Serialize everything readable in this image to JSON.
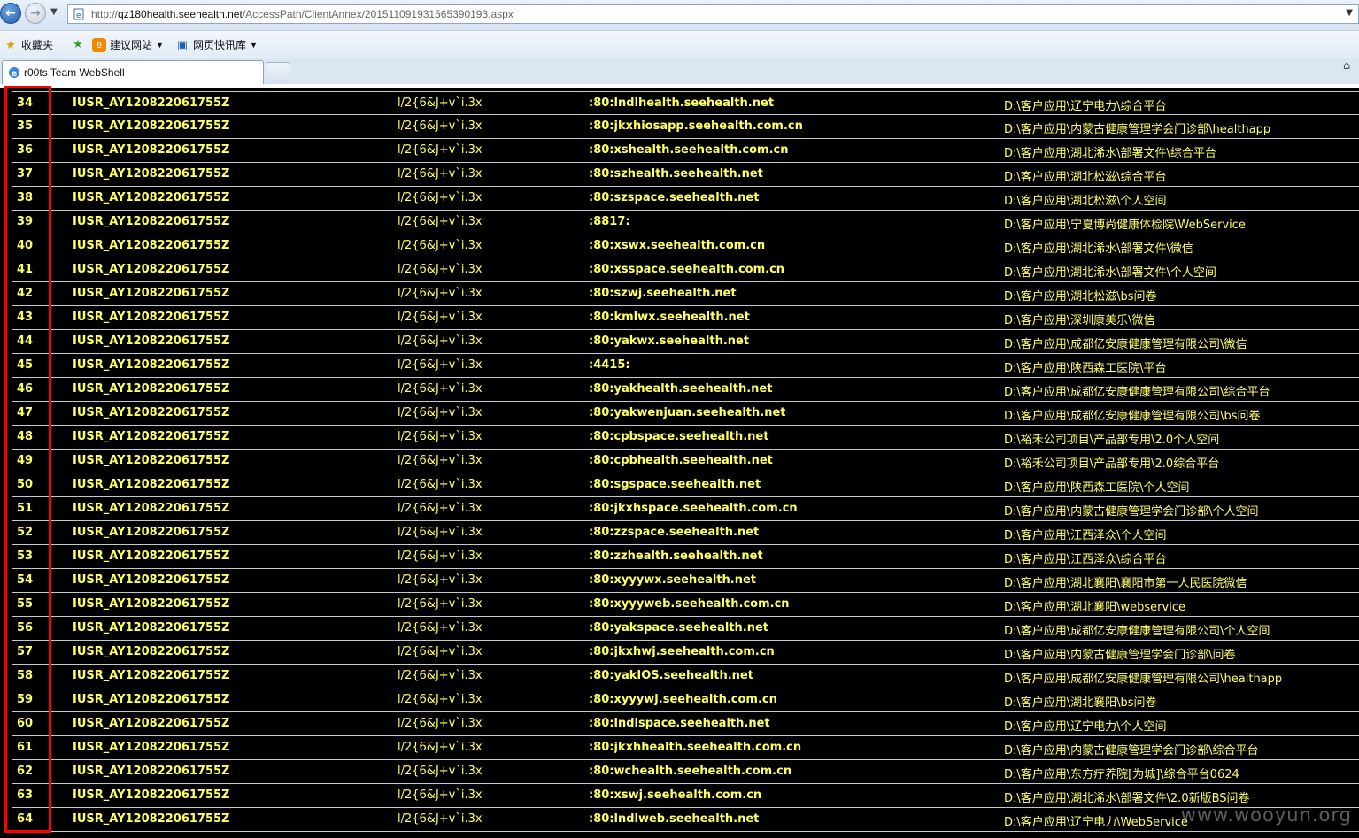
{
  "browser": {
    "url_prefix": "http://",
    "url_host": "qz180health.seehealth.net",
    "url_path": "/AccessPath/ClientAnnex/201511091931565390193.aspx",
    "favorites_label": "收藏夹",
    "fav_items": [
      "建议网站",
      "网页快讯库"
    ],
    "tab_title": "r00ts Team WebShell"
  },
  "table": {
    "user": "IUSR_AY120822061755Z",
    "password": "l/2{6&J+v`i.3x",
    "rows": [
      {
        "id": "34",
        "binding": ":80:lndlhealth.seehealth.net",
        "path": "D:\\客户应用\\辽宁电力\\综合平台"
      },
      {
        "id": "35",
        "binding": ":80:jkxhiosapp.seehealth.com.cn",
        "path": "D:\\客户应用\\内蒙古健康管理学会门诊部\\healthapp"
      },
      {
        "id": "36",
        "binding": ":80:xshealth.seehealth.com.cn",
        "path": "D:\\客户应用\\湖北浠水\\部署文件\\综合平台"
      },
      {
        "id": "37",
        "binding": ":80:szhealth.seehealth.net",
        "path": "D:\\客户应用\\湖北松滋\\综合平台"
      },
      {
        "id": "38",
        "binding": ":80:szspace.seehealth.net",
        "path": "D:\\客户应用\\湖北松滋\\个人空间"
      },
      {
        "id": "39",
        "binding": ":8817:",
        "path": "D:\\客户应用\\宁夏博尚健康体检院\\WebService"
      },
      {
        "id": "40",
        "binding": ":80:xswx.seehealth.com.cn",
        "path": "D:\\客户应用\\湖北浠水\\部署文件\\微信"
      },
      {
        "id": "41",
        "binding": ":80:xsspace.seehealth.com.cn",
        "path": "D:\\客户应用\\湖北浠水\\部署文件\\个人空间"
      },
      {
        "id": "42",
        "binding": ":80:szwj.seehealth.net",
        "path": "D:\\客户应用\\湖北松滋\\bs问卷"
      },
      {
        "id": "43",
        "binding": ":80:kmlwx.seehealth.net",
        "path": "D:\\客户应用\\深圳康美乐\\微信"
      },
      {
        "id": "44",
        "binding": ":80:yakwx.seehealth.net",
        "path": "D:\\客户应用\\成都亿安康健康管理有限公司\\微信"
      },
      {
        "id": "45",
        "binding": ":4415:",
        "path": "D:\\客户应用\\陕西森工医院\\平台"
      },
      {
        "id": "46",
        "binding": ":80:yakhealth.seehealth.net",
        "path": "D:\\客户应用\\成都亿安康健康管理有限公司\\综合平台"
      },
      {
        "id": "47",
        "binding": ":80:yakwenjuan.seehealth.net",
        "path": "D:\\客户应用\\成都亿安康健康管理有限公司\\bs问卷"
      },
      {
        "id": "48",
        "binding": ":80:cpbspace.seehealth.net",
        "path": "D:\\裕禾公司项目\\产品部专用\\2.0个人空间"
      },
      {
        "id": "49",
        "binding": ":80:cpbhealth.seehealth.net",
        "path": "D:\\裕禾公司项目\\产品部专用\\2.0综合平台"
      },
      {
        "id": "50",
        "binding": ":80:sgspace.seehealth.net",
        "path": "D:\\客户应用\\陕西森工医院\\个人空间"
      },
      {
        "id": "51",
        "binding": ":80:jkxhspace.seehealth.com.cn",
        "path": "D:\\客户应用\\内蒙古健康管理学会门诊部\\个人空间"
      },
      {
        "id": "52",
        "binding": ":80:zzspace.seehealth.net",
        "path": "D:\\客户应用\\江西泽众\\个人空间"
      },
      {
        "id": "53",
        "binding": ":80:zzhealth.seehealth.net",
        "path": "D:\\客户应用\\江西泽众\\综合平台"
      },
      {
        "id": "54",
        "binding": ":80:xyyywx.seehealth.net",
        "path": "D:\\客户应用\\湖北襄阳\\襄阳市第一人民医院微信"
      },
      {
        "id": "55",
        "binding": ":80:xyyyweb.seehealth.com.cn",
        "path": "D:\\客户应用\\湖北襄阳\\webservice"
      },
      {
        "id": "56",
        "binding": ":80:yakspace.seehealth.net",
        "path": "D:\\客户应用\\成都亿安康健康管理有限公司\\个人空间"
      },
      {
        "id": "57",
        "binding": ":80:jkxhwj.seehealth.com.cn",
        "path": "D:\\客户应用\\内蒙古健康管理学会门诊部\\问卷"
      },
      {
        "id": "58",
        "binding": ":80:yakIOS.seehealth.net",
        "path": "D:\\客户应用\\成都亿安康健康管理有限公司\\healthapp"
      },
      {
        "id": "59",
        "binding": ":80:xyyywj.seehealth.com.cn",
        "path": "D:\\客户应用\\湖北襄阳\\bs问卷"
      },
      {
        "id": "60",
        "binding": ":80:lndlspace.seehealth.net",
        "path": "D:\\客户应用\\辽宁电力\\个人空间"
      },
      {
        "id": "61",
        "binding": ":80:jkxhhealth.seehealth.com.cn",
        "path": "D:\\客户应用\\内蒙古健康管理学会门诊部\\综合平台"
      },
      {
        "id": "62",
        "binding": ":80:wchealth.seehealth.com.cn",
        "path": "D:\\客户应用\\东方疗养院[为城]\\综合平台0624"
      },
      {
        "id": "63",
        "binding": ":80:xswj.seehealth.com.cn",
        "path": "D:\\客户应用\\湖北浠水\\部署文件\\2.0新版BS问卷"
      },
      {
        "id": "64",
        "binding": ":80:lndlweb.seehealth.net",
        "path": "D:\\客户应用\\辽宁电力\\WebService"
      }
    ]
  },
  "watermark": "www.wooyun.org",
  "colors": {
    "text": "#ffff66",
    "background": "#000000",
    "highlight": "#ff0000"
  },
  "icons": [
    "back-arrow-icon",
    "forward-arrow-icon",
    "page-icon",
    "star-icon",
    "favorites-add-icon",
    "suggested-sites-icon",
    "web-slice-icon",
    "ie-tab-icon",
    "home-icon"
  ]
}
